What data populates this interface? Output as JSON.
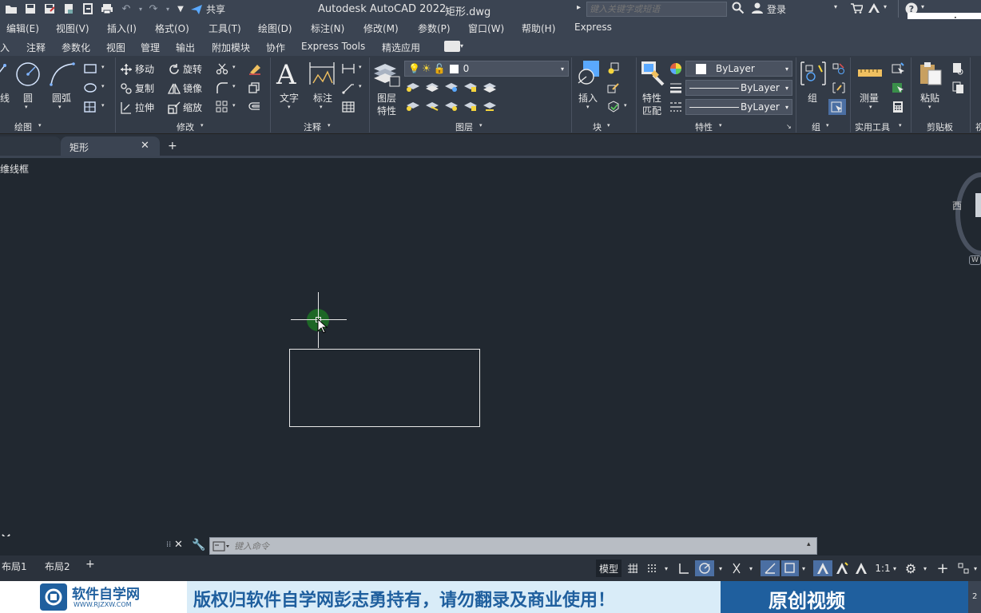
{
  "app": {
    "title": "Autodesk AutoCAD 2022",
    "filename": "矩形.dwg",
    "share_label": "共享",
    "search_placeholder": "键入关键字或短语",
    "login_label": "登录",
    "watermark_url": "www.rjzxw"
  },
  "menu": [
    "编辑(E)",
    "视图(V)",
    "插入(I)",
    "格式(O)",
    "工具(T)",
    "绘图(D)",
    "标注(N)",
    "修改(M)",
    "参数(P)",
    "窗口(W)",
    "帮助(H)",
    "Express"
  ],
  "ribbon_tabs": [
    "入",
    "注释",
    "参数化",
    "视图",
    "管理",
    "输出",
    "附加模块",
    "协作",
    "Express Tools",
    "精选应用"
  ],
  "draw_panel": {
    "line": "线",
    "circle": "圆",
    "arc": "圆弧",
    "title": "绘图"
  },
  "modify_panel": {
    "move": "移动",
    "rotate": "旋转",
    "copy": "复制",
    "mirror": "镜像",
    "stretch": "拉伸",
    "scale": "缩放",
    "title": "修改"
  },
  "annotation_panel": {
    "text": "文字",
    "dimension": "标注",
    "title": "注释"
  },
  "layers_panel": {
    "layer_props_1": "图层",
    "layer_props_2": "特性",
    "layer_name": "0",
    "title": "图层"
  },
  "block_panel": {
    "insert": "插入",
    "title": "块"
  },
  "properties_panel": {
    "match_1": "特性",
    "match_2": "匹配",
    "color": "ByLayer",
    "linetype": "ByLayer",
    "lineweight": "ByLayer",
    "title": "特性"
  },
  "groups_panel": {
    "group": "组",
    "title": "组"
  },
  "utilities_panel": {
    "measure": "测量",
    "title": "实用工具"
  },
  "clipboard_panel": {
    "paste": "粘贴",
    "title": "剪贴板"
  },
  "extra_panel": {
    "title": "视"
  },
  "file_tab": {
    "name": "矩形"
  },
  "viewport": {
    "label": "维线框",
    "viewcube_west": "西",
    "wcs": "W"
  },
  "command": {
    "placeholder": "键入命令"
  },
  "layout_tabs": [
    "布局1",
    "布局2"
  ],
  "status": {
    "model": "模型",
    "scale": "1:1"
  },
  "banner": {
    "logo": "软件自学网",
    "logo_url": "WWW.RJZXW.COM",
    "notice": "版权归软件自学网彭志勇持有，请勿翻录及商业使用！",
    "original": "原创视频",
    "page": "2"
  },
  "colors": {
    "canvas": "#212830",
    "ribbon": "#333b47",
    "titlebar": "#3b4452",
    "accent": "#4b6fa3",
    "osnap": "#1e7a2a",
    "banner_blue": "#1f5f9e"
  }
}
